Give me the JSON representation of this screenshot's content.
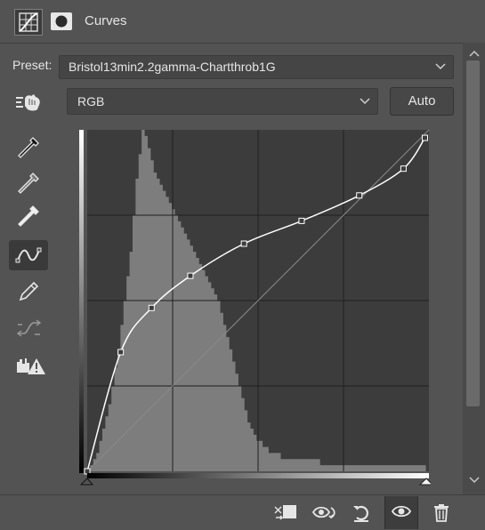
{
  "header": {
    "title": "Curves"
  },
  "preset": {
    "label": "Preset:",
    "value": "Bristol13min2.2gamma-Chartthrob1G"
  },
  "channel": {
    "value": "RGB"
  },
  "auto_button": {
    "label": "Auto"
  },
  "tools": [
    "target-adjust-icon",
    "sample-black-point-icon",
    "sample-gray-point-icon",
    "sample-white-point-icon",
    "curve-edit-icon",
    "pencil-icon",
    "smooth-icon",
    "clipping-warning-icon"
  ],
  "curve": {
    "input_range": [
      0,
      255
    ],
    "output_range": [
      0,
      255
    ],
    "grid_divisions": 4,
    "control_points": [
      [
        0,
        0
      ],
      [
        25,
        89
      ],
      [
        48,
        122
      ],
      [
        77,
        146
      ],
      [
        117,
        170
      ],
      [
        160,
        187
      ],
      [
        203,
        206
      ],
      [
        236,
        226
      ],
      [
        252,
        249
      ]
    ]
  },
  "histogram": {
    "counts": [
      0,
      1,
      2,
      3,
      5,
      7,
      9,
      11,
      14,
      17,
      20,
      24,
      28,
      32,
      36,
      42,
      48,
      52,
      56,
      55,
      53,
      51,
      49,
      48,
      47,
      46,
      45,
      44,
      43,
      42,
      41,
      40,
      39,
      38,
      37,
      36,
      35,
      34,
      33,
      32,
      31,
      30,
      29,
      28,
      26,
      24,
      22,
      20,
      18,
      16,
      14,
      12,
      10,
      8,
      7,
      6,
      5,
      5,
      4,
      4,
      3,
      3,
      3,
      3,
      2,
      2,
      2,
      2,
      2,
      2,
      2,
      2,
      2,
      2,
      2,
      2,
      2,
      1,
      1,
      1,
      1,
      1,
      1,
      1,
      1,
      1,
      1,
      1,
      1,
      1,
      1,
      1,
      1,
      1,
      1,
      1,
      1,
      1,
      1,
      1,
      1,
      1,
      1,
      1,
      1,
      1,
      1,
      1,
      1,
      1,
      1,
      1,
      0
    ]
  },
  "footer": {
    "buttons": [
      "clip-to-layer-icon",
      "view-previous-state-icon",
      "reset-icon",
      "toggle-visibility-icon",
      "delete-icon"
    ]
  }
}
